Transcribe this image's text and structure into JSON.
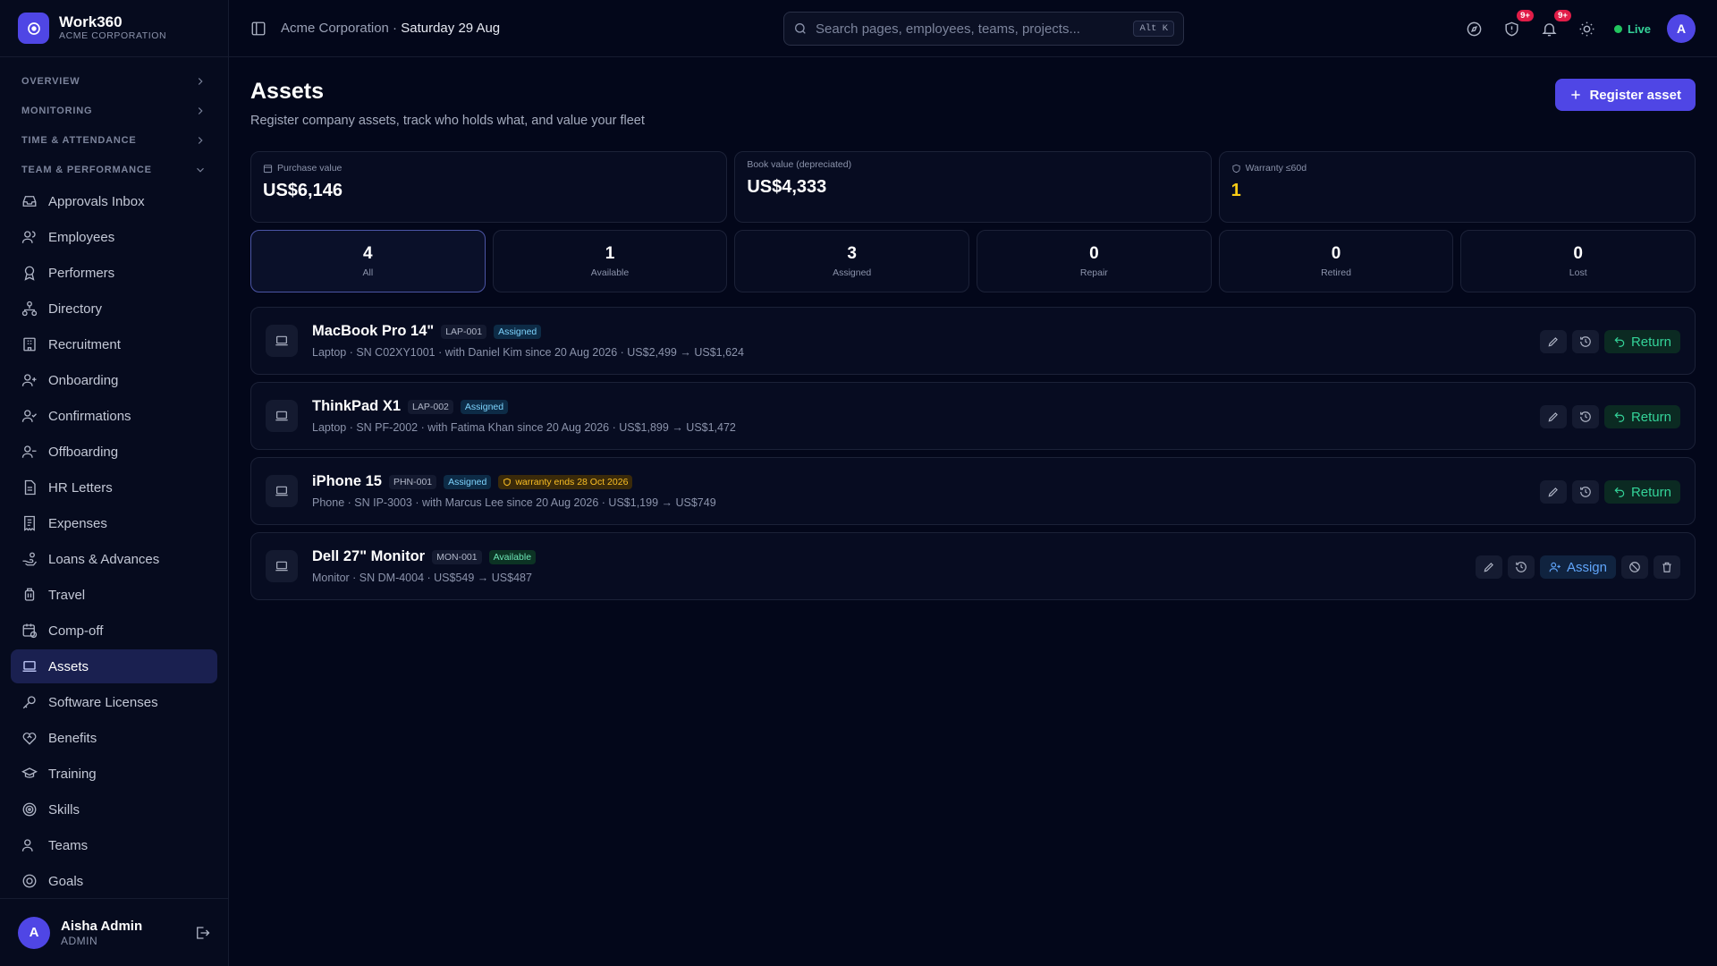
{
  "brand": {
    "name": "Work360",
    "org": "ACME CORPORATION"
  },
  "nav": {
    "groups": {
      "overview": "OVERVIEW",
      "monitoring": "MONITORING",
      "time": "TIME & ATTENDANCE",
      "team": "TEAM & PERFORMANCE"
    },
    "items": [
      {
        "label": "Approvals Inbox",
        "icon": "inbox-icon"
      },
      {
        "label": "Employees",
        "icon": "users-icon"
      },
      {
        "label": "Performers",
        "icon": "award-icon"
      },
      {
        "label": "Directory",
        "icon": "sitemap-icon"
      },
      {
        "label": "Recruitment",
        "icon": "building-icon"
      },
      {
        "label": "Onboarding",
        "icon": "user-plus-icon"
      },
      {
        "label": "Confirmations",
        "icon": "user-check-icon"
      },
      {
        "label": "Offboarding",
        "icon": "user-minus-icon"
      },
      {
        "label": "HR Letters",
        "icon": "file-text-icon"
      },
      {
        "label": "Expenses",
        "icon": "receipt-icon"
      },
      {
        "label": "Loans & Advances",
        "icon": "hand-coins-icon"
      },
      {
        "label": "Travel",
        "icon": "luggage-icon"
      },
      {
        "label": "Comp-off",
        "icon": "calendar-clock-icon"
      },
      {
        "label": "Assets",
        "icon": "laptop-icon"
      },
      {
        "label": "Software Licenses",
        "icon": "key-icon"
      },
      {
        "label": "Benefits",
        "icon": "heart-handshake-icon"
      },
      {
        "label": "Training",
        "icon": "graduation-cap-icon"
      },
      {
        "label": "Skills",
        "icon": "target-icon"
      },
      {
        "label": "Teams",
        "icon": "team-icon"
      },
      {
        "label": "Goals",
        "icon": "goal-icon"
      }
    ]
  },
  "user": {
    "name": "Aisha Admin",
    "role": "ADMIN",
    "initial": "A"
  },
  "topbar": {
    "org": "Acme Corporation",
    "date": "Saturday 29 Aug",
    "search_placeholder": "Search pages, employees, teams, projects...",
    "shortcut": "Alt K",
    "badge_approvals": "9+",
    "badge_notifications": "9+",
    "live": "Live",
    "avatar_initial": "A"
  },
  "page": {
    "title": "Assets",
    "subtitle": "Register company assets, track who holds what, and value your fleet",
    "register_button": "Register asset"
  },
  "stats": {
    "purchase": {
      "label": "Purchase value",
      "value": "US$6,146"
    },
    "book": {
      "label": "Book value (depreciated)",
      "value": "US$4,333"
    },
    "warranty": {
      "label": "Warranty ≤60d",
      "value": "1",
      "color": "#facc15"
    }
  },
  "filters": [
    {
      "count": "4",
      "label": "All"
    },
    {
      "count": "1",
      "label": "Available"
    },
    {
      "count": "3",
      "label": "Assigned"
    },
    {
      "count": "0",
      "label": "Repair"
    },
    {
      "count": "0",
      "label": "Retired"
    },
    {
      "count": "0",
      "label": "Lost"
    }
  ],
  "assets": [
    {
      "name": "MacBook Pro 14\"",
      "tag": "LAP-001",
      "status": "Assigned",
      "warning": "",
      "meta": "Laptop · SN C02XY1001 · with Daniel Kim since 20 Aug 2026 · US$2,499 → US$1,624",
      "action": "Return"
    },
    {
      "name": "ThinkPad X1",
      "tag": "LAP-002",
      "status": "Assigned",
      "warning": "",
      "meta": "Laptop · SN PF-2002 · with Fatima Khan since 20 Aug 2026 · US$1,899 → US$1,472",
      "action": "Return"
    },
    {
      "name": "iPhone 15",
      "tag": "PHN-001",
      "status": "Assigned",
      "warning": "warranty ends 28 Oct 2026",
      "meta": "Phone · SN IP-3003 · with Marcus Lee since 20 Aug 2026 · US$1,199 → US$749",
      "action": "Return"
    },
    {
      "name": "Dell 27\" Monitor",
      "tag": "MON-001",
      "status": "Available",
      "warning": "",
      "meta": "Monitor · SN DM-4004 · US$549 → US$487",
      "action": "Assign"
    }
  ],
  "colors": {
    "accent": "#4f46e5",
    "live": "#22c55e",
    "return": "#34d399",
    "assign": "#60a5fa"
  }
}
